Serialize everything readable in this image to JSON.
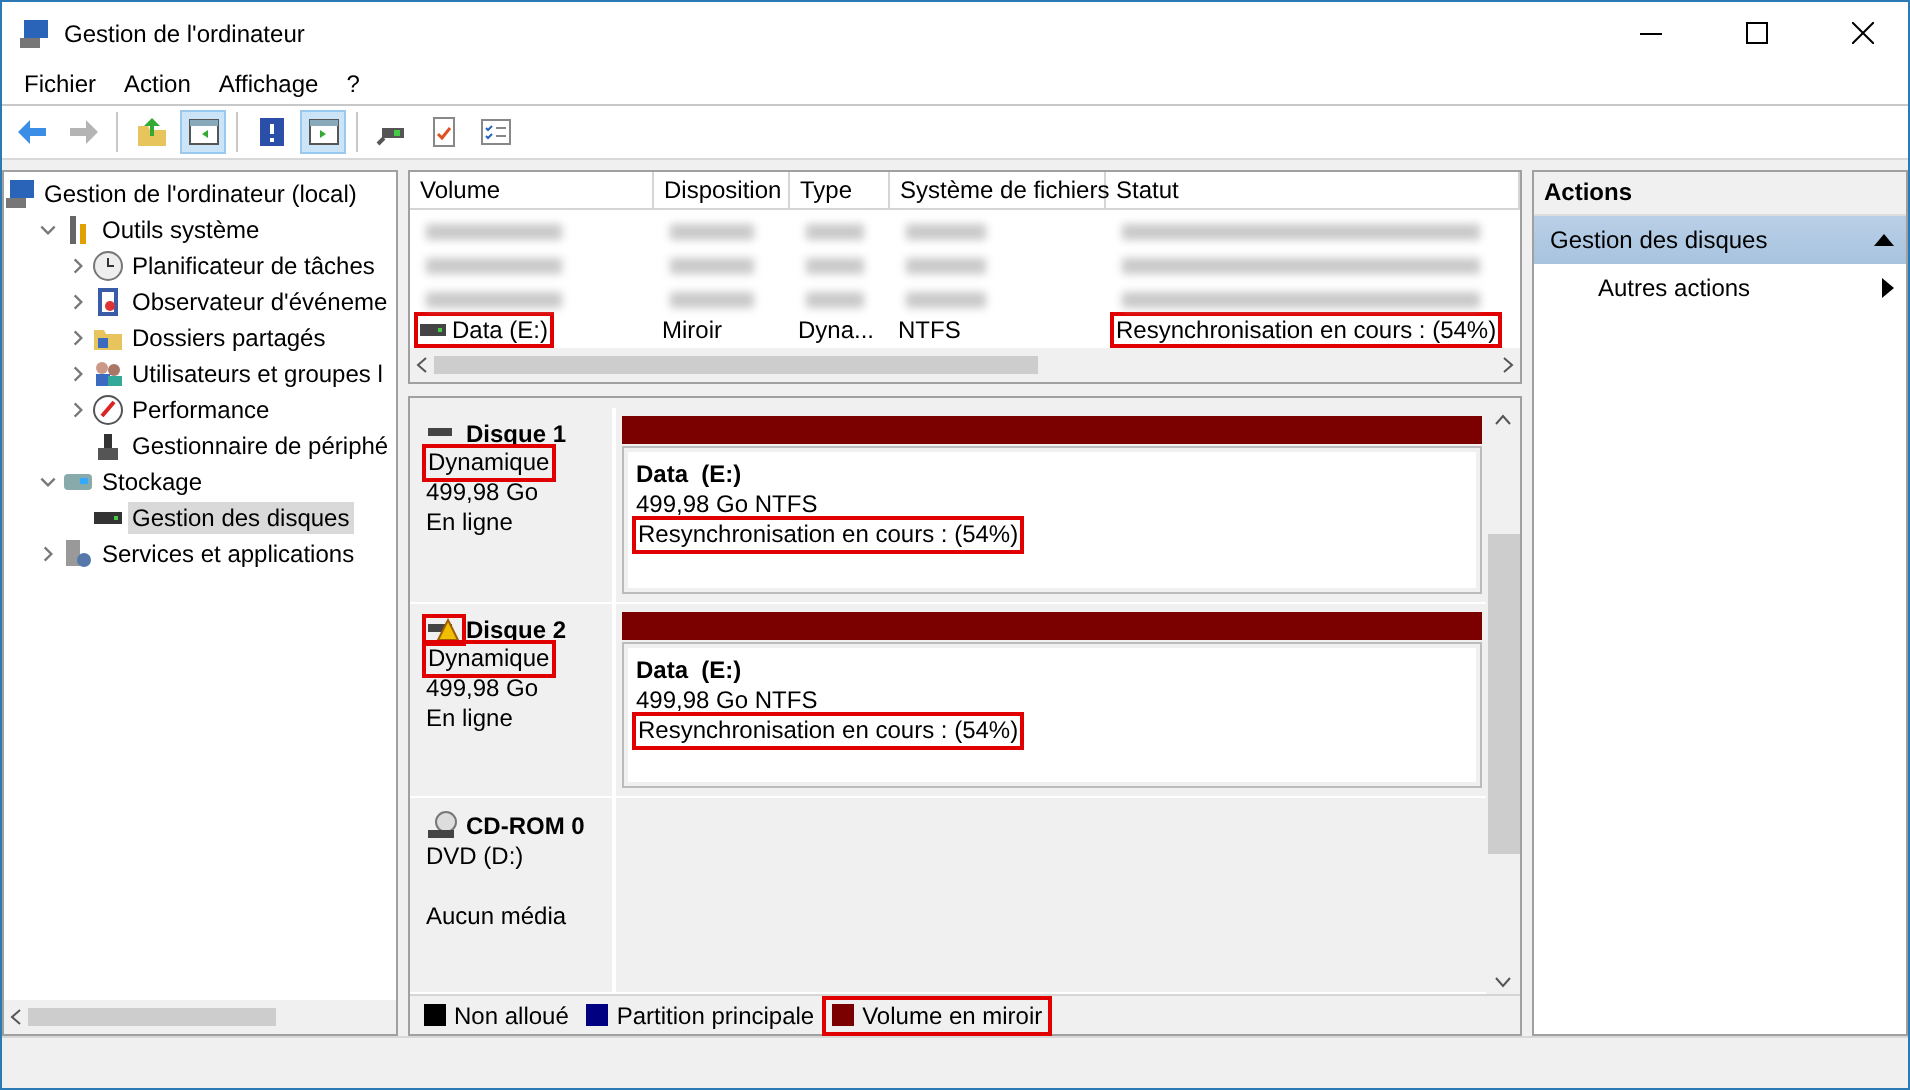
{
  "window": {
    "title": "Gestion de l'ordinateur"
  },
  "menu": [
    "Fichier",
    "Action",
    "Affichage",
    "?"
  ],
  "toolbar": [
    {
      "pressed": false,
      "disabled": false
    },
    {
      "pressed": false,
      "disabled": true
    },
    {
      "pressed": false,
      "disabled": false
    },
    {
      "pressed": true,
      "disabled": false
    },
    {
      "pressed": false,
      "disabled": false
    },
    {
      "pressed": true,
      "disabled": false
    },
    {
      "pressed": false,
      "disabled": false
    },
    {
      "pressed": false,
      "disabled": false
    },
    {
      "pressed": false,
      "disabled": false
    }
  ],
  "tree": [
    {
      "label": "Gestion de l'ordinateur (local)",
      "selected": false,
      "children": [
        {
          "label": "Outils système",
          "expanded": true,
          "selected": false,
          "children": [
            {
              "label": "Planificateur de tâches",
              "expanded": false,
              "selected": false
            },
            {
              "label": "Observateur d'événeme",
              "expanded": false,
              "selected": false
            },
            {
              "label": "Dossiers partagés",
              "expanded": false,
              "selected": false
            },
            {
              "label": "Utilisateurs et groupes l",
              "expanded": false,
              "selected": false
            },
            {
              "label": "Performance",
              "expanded": false,
              "selected": false
            },
            {
              "label": "Gestionnaire de périphé",
              "selected": false
            }
          ]
        },
        {
          "label": "Stockage",
          "expanded": true,
          "selected": false,
          "children": [
            {
              "label": "Gestion des disques",
              "selected": true
            }
          ]
        },
        {
          "label": "Services et applications",
          "expanded": false,
          "selected": false
        }
      ]
    }
  ],
  "volume_table": {
    "columns": [
      "Volume",
      "Disposition",
      "Type",
      "Système de fichiers",
      "Statut"
    ],
    "rows": [
      {
        "kind": "blurred"
      },
      {
        "kind": "blurred"
      },
      {
        "kind": "blurred"
      },
      {
        "kind": "volume",
        "volume": "Data (E:)",
        "volume_highlighted": true,
        "disposition": "Miroir",
        "type": "Dyna...",
        "file_system": "NTFS",
        "status": "Resynchronisation en cours : (54%)",
        "status_highlighted": true
      }
    ]
  },
  "disks": [
    {
      "kind": "disk",
      "name": "Disque 1",
      "warning": false,
      "icon_highlighted": false,
      "disk_type": "Dynamique",
      "type_highlighted": true,
      "size": "499,98 Go",
      "state": "En ligne",
      "partition": {
        "name": "Data  (E:)",
        "color": "#7b0000",
        "detail": "499,98 Go NTFS",
        "status": "Resynchronisation en cours : (54%)",
        "status_highlighted": true
      }
    },
    {
      "kind": "disk",
      "name": "Disque 2",
      "warning": true,
      "icon_highlighted": true,
      "disk_type": "Dynamique",
      "type_highlighted": true,
      "size": "499,98 Go",
      "state": "En ligne",
      "partition": {
        "name": "Data  (E:)",
        "color": "#7b0000",
        "detail": "499,98 Go NTFS",
        "status": "Resynchronisation en cours : (54%)",
        "status_highlighted": true
      }
    },
    {
      "kind": "cdrom",
      "name": "CD-ROM 0",
      "disk_type": "DVD (D:)",
      "state": "Aucun média"
    }
  ],
  "legend": [
    {
      "label": "Non alloué",
      "color": "#000000",
      "highlighted": false
    },
    {
      "label": "Partition principale",
      "color": "#000080",
      "highlighted": false
    },
    {
      "label": "Volume en miroir",
      "color": "#7b0000",
      "highlighted": true
    }
  ],
  "actions": {
    "title": "Actions",
    "section": {
      "label": "Gestion des disques",
      "expanded": true
    },
    "items": [
      "Autres actions"
    ]
  }
}
